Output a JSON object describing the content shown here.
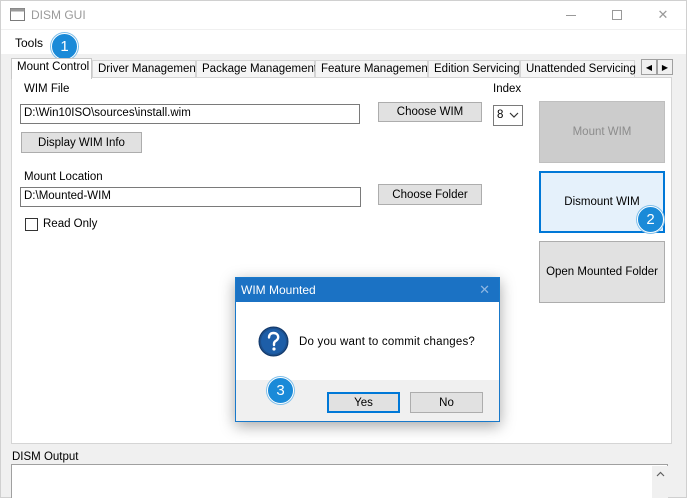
{
  "window": {
    "title": "DISM GUI",
    "close_glyph": "✕"
  },
  "menu": {
    "tools_label": "Tools"
  },
  "tabs": [
    {
      "label": "Mount Control"
    },
    {
      "label": "Driver Management"
    },
    {
      "label": "Package Management"
    },
    {
      "label": "Feature Management"
    },
    {
      "label": "Edition Servicing"
    },
    {
      "label": "Unattended Servicing"
    }
  ],
  "tab_scroll": {
    "left": "◀",
    "right": "▶"
  },
  "mount_control": {
    "wim_file_label": "WIM File",
    "wim_file_value": "D:\\Win10ISO\\sources\\install.wim",
    "choose_wim_label": "Choose WIM",
    "index_label": "Index",
    "index_value": "8",
    "display_wim_info_label": "Display WIM Info",
    "mount_location_label": "Mount Location",
    "mount_location_value": "D:\\Mounted-WIM",
    "choose_folder_label": "Choose Folder",
    "read_only_label": "Read Only",
    "mount_wim_label": "Mount WIM",
    "dismount_wim_label": "Dismount WIM",
    "open_mounted_folder_label": "Open Mounted Folder"
  },
  "dialog": {
    "title": "WIM Mounted",
    "close_glyph": "✕",
    "message": "Do you want to commit changes?",
    "yes_label": "Yes",
    "no_label": "No",
    "icon": "question-icon"
  },
  "output": {
    "label": "DISM Output"
  },
  "annotations": [
    {
      "number": "1"
    },
    {
      "number": "2"
    },
    {
      "number": "3"
    }
  ],
  "colors": {
    "accent": "#0078d7",
    "dialog_titlebar": "#1b72c4",
    "badge": "#1a8ad8"
  }
}
